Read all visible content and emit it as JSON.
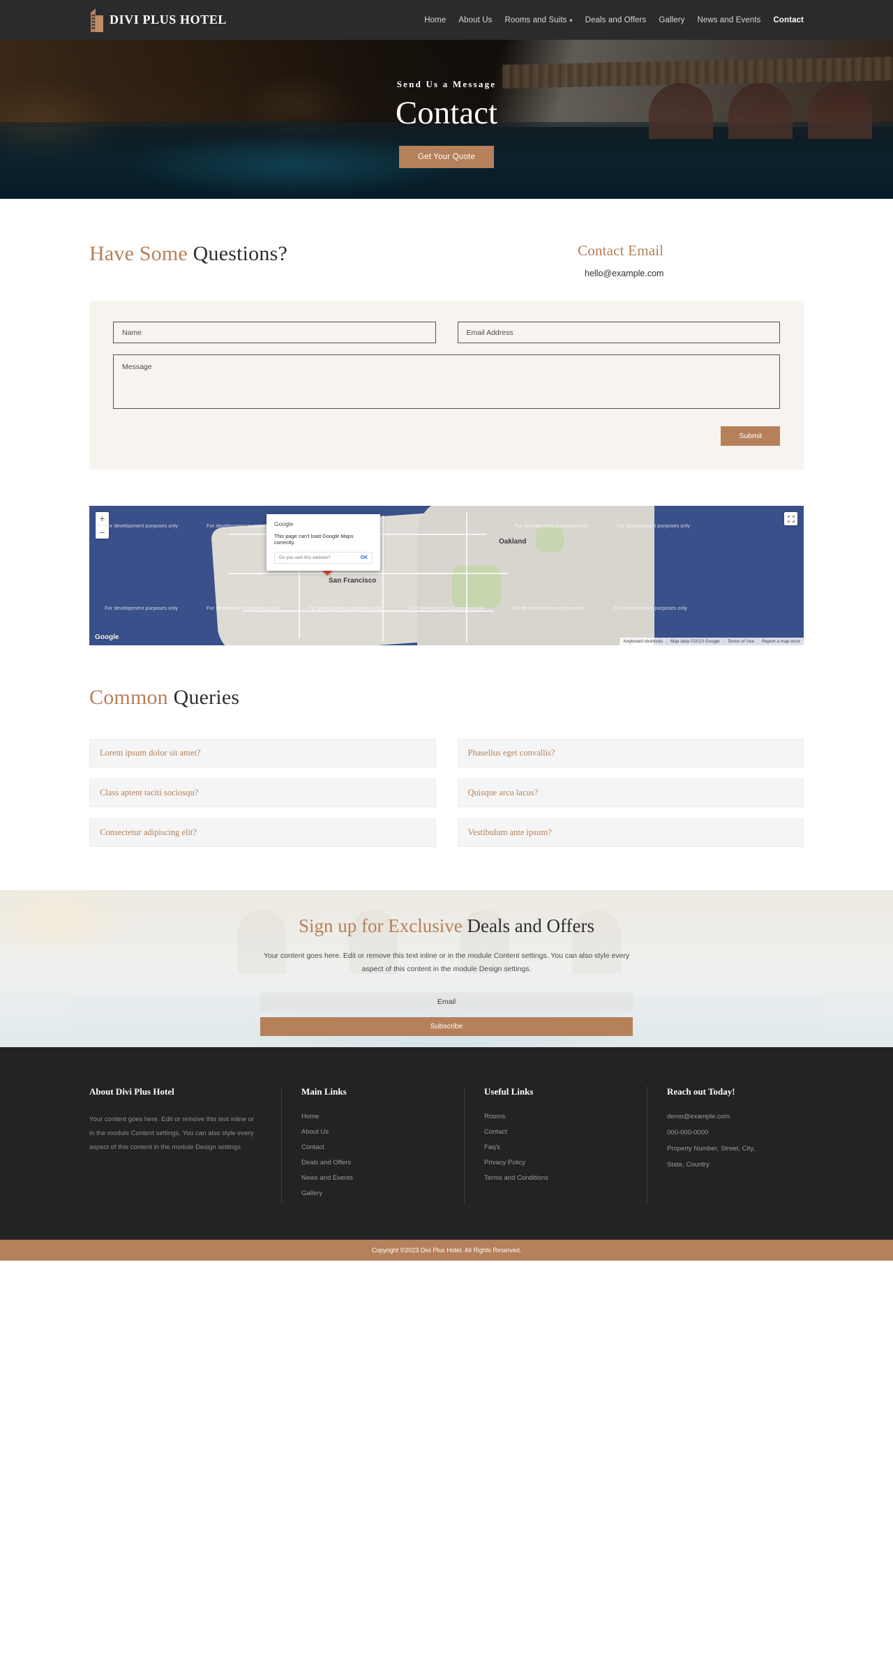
{
  "header": {
    "brand": "DIVI PLUS HOTEL",
    "nav": [
      {
        "label": "Home",
        "active": false,
        "caret": false
      },
      {
        "label": "About Us",
        "active": false,
        "caret": false
      },
      {
        "label": "Rooms and Suits",
        "active": false,
        "caret": true
      },
      {
        "label": "Deals and Offers",
        "active": false,
        "caret": false
      },
      {
        "label": "Gallery",
        "active": false,
        "caret": false
      },
      {
        "label": "News and Events",
        "active": false,
        "caret": false
      },
      {
        "label": "Contact",
        "active": true,
        "caret": false
      }
    ]
  },
  "hero": {
    "subtitle": "Send Us a Message",
    "title": "Contact",
    "cta": "Get Your Quote"
  },
  "questions": {
    "heading_accent": "Have Some ",
    "heading_rest": "Questions?",
    "email_label": "Contact Email",
    "email_value": "hello@example.com"
  },
  "form": {
    "name_placeholder": "Name",
    "email_placeholder": "Email Address",
    "message_placeholder": "Message",
    "submit_label": "Submit"
  },
  "map": {
    "watermark": "For development purposes only",
    "city_label": "San Francisco",
    "city_label_2": "Oakland",
    "logo": "Google",
    "zoom_in": "+",
    "zoom_out": "−",
    "fullscreen_icon": "fullscreen-icon",
    "footer_items": [
      "Keyboard shortcuts",
      "Map data ©2023 Google",
      "Terms of Use",
      "Report a map error"
    ],
    "dialog": {
      "title": "Google",
      "message": "This page can't load Google Maps correctly.",
      "question": "Do you own this website?",
      "ok": "OK"
    }
  },
  "faq": {
    "heading_accent": "Common ",
    "heading_rest": "Queries",
    "items": [
      "Lorem ipsum dolor sit amet?",
      "Phasellus eget convallis?",
      "Class aptent taciti sociosqu?",
      "Quisque arcu lacus?",
      "Consectetur adipiscing elit?",
      "Vestibulum ante ipsum?"
    ]
  },
  "newsletter": {
    "title_accent": "Sign up for Exclusive ",
    "title_rest": "Deals and Offers",
    "text": "Your content goes here. Edit or remove this text inline or in the module Content settings. You can also style every aspect of this content in the module Design settings.",
    "email_placeholder": "Email",
    "subscribe_label": "Subscribe"
  },
  "footer": {
    "col1": {
      "title": "About Divi Plus Hotel",
      "text": "Your content goes here. Edit or remove this text inline or in the module Content settings. You can also style every aspect of this content in the module Design settings"
    },
    "col2": {
      "title": "Main Links",
      "links": [
        "Home",
        "About Us",
        "Contact",
        "Deals and Offers",
        "News and Events",
        "Gallery"
      ]
    },
    "col3": {
      "title": "Useful Links",
      "links": [
        "Rooms",
        "Contact",
        "Faq's",
        "Privacy Policy",
        "Terms and Conditions"
      ]
    },
    "col4": {
      "title": "Reach out Today!",
      "items": [
        "demo@example.com",
        "000-000-0000",
        "Property Number, Street, City,",
        "State, Country"
      ]
    },
    "copyright": "Copyright ©2023 Divi Plus Hotel. All Rights Reserved."
  },
  "colors": {
    "accent": "#b5805a",
    "dark": "#232323",
    "header_dark": "#2b2b2b",
    "form_bg": "#f7f4ef"
  }
}
